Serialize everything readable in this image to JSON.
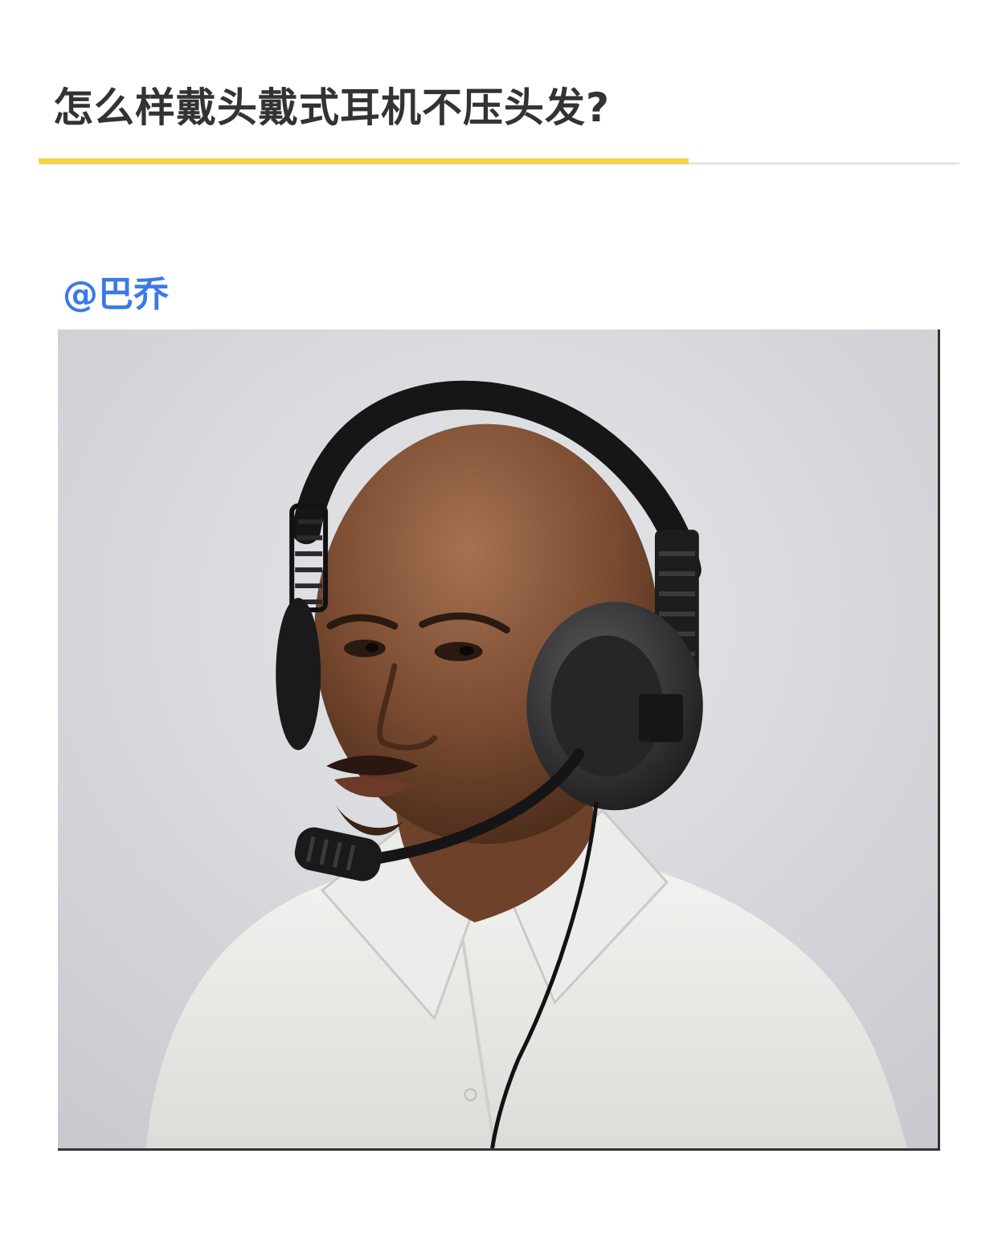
{
  "question": {
    "title": "怎么样戴头戴式耳机不压头发?"
  },
  "answer": {
    "author_mention": "@巴乔"
  },
  "photo": {
    "subject": "photo-man-wearing-headset"
  },
  "colors": {
    "title_text": "#333333",
    "divider_accent": "#f5d547",
    "divider_track": "#e4e4e4",
    "mention_link": "#3b7ae5"
  }
}
